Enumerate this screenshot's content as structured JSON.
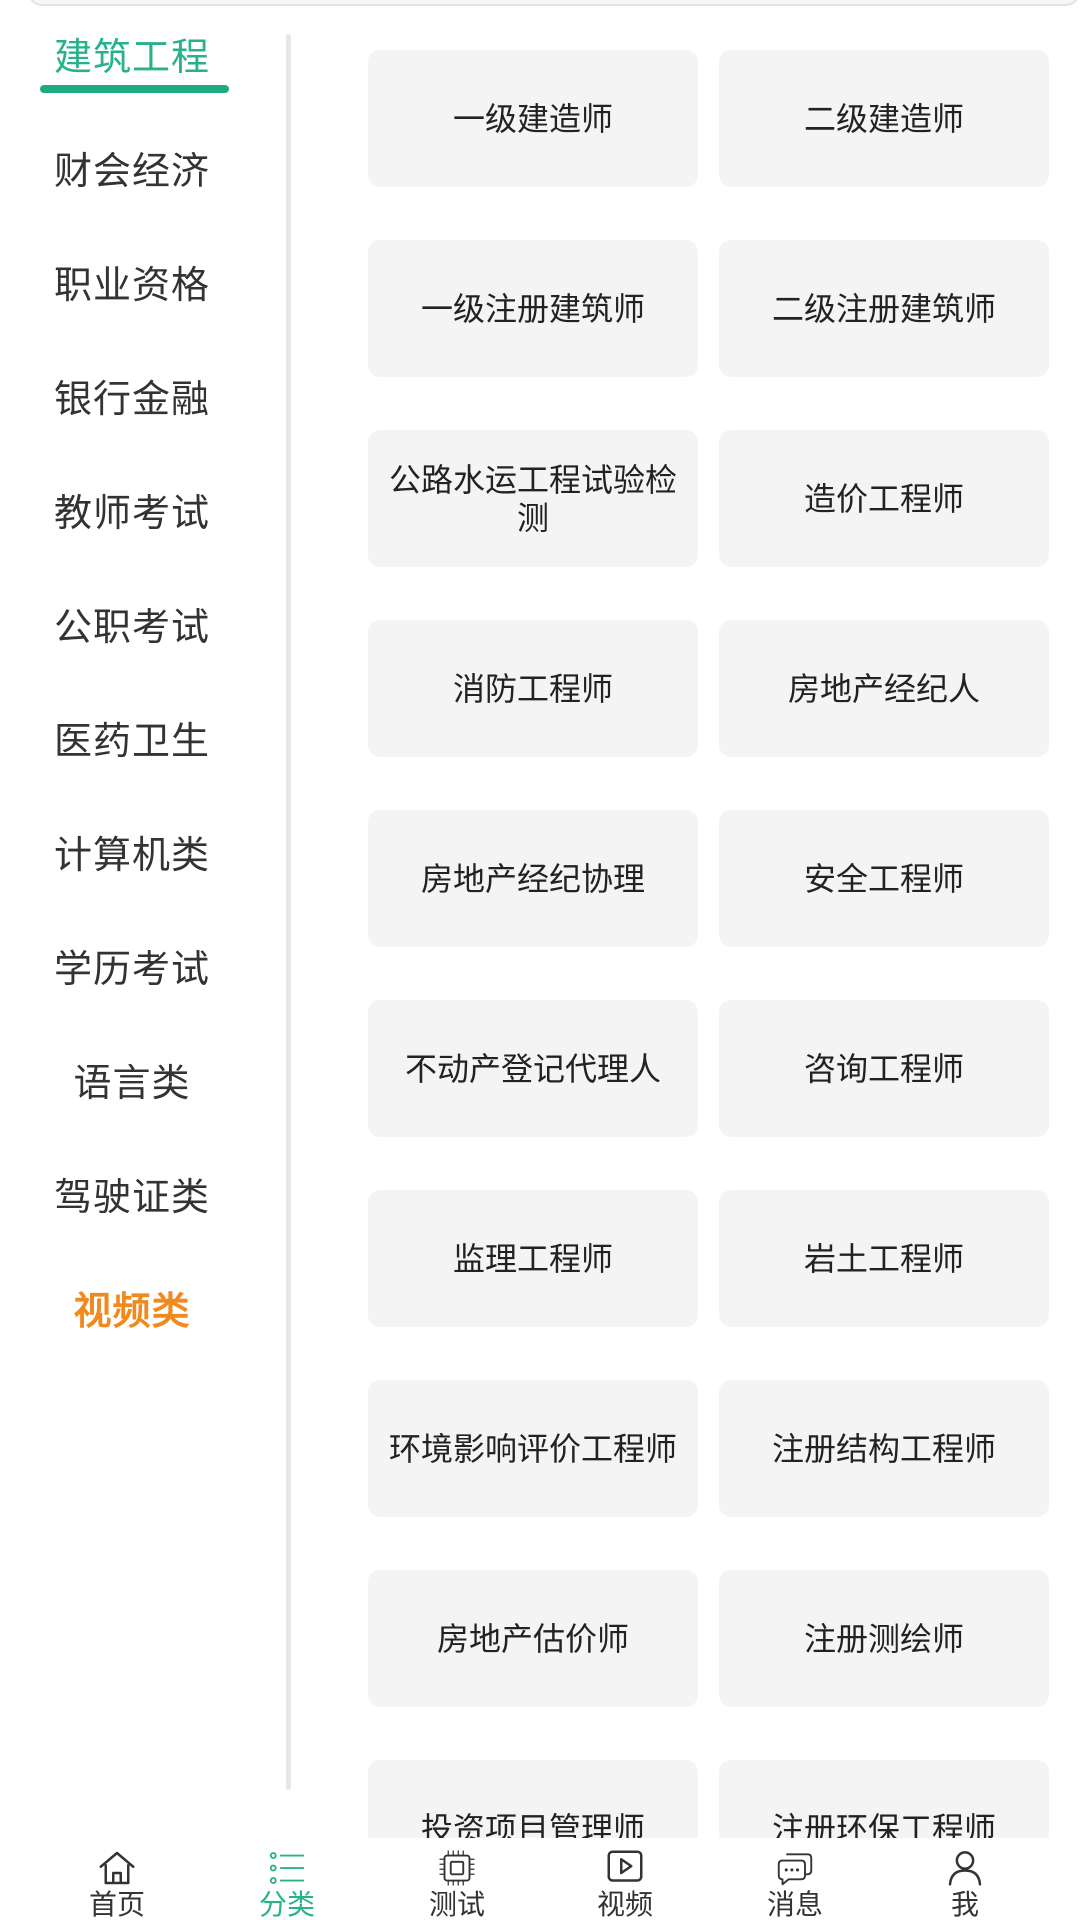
{
  "sidebar": {
    "items": [
      {
        "label": "建筑工程"
      },
      {
        "label": "财会经济"
      },
      {
        "label": "职业资格"
      },
      {
        "label": "银行金融"
      },
      {
        "label": "教师考试"
      },
      {
        "label": "公职考试"
      },
      {
        "label": "医药卫生"
      },
      {
        "label": "计算机类"
      },
      {
        "label": "学历考试"
      },
      {
        "label": "语言类"
      },
      {
        "label": "驾驶证类"
      },
      {
        "label": "视频类"
      }
    ],
    "active_index": 0,
    "active_color": "#27b28b",
    "highlight_color": "#f08a1f"
  },
  "categories": [
    {
      "label": "一级建造师"
    },
    {
      "label": "二级建造师"
    },
    {
      "label": "一级注册建筑师"
    },
    {
      "label": "二级注册建筑师"
    },
    {
      "label": "公路水运工程试验检测"
    },
    {
      "label": "造价工程师"
    },
    {
      "label": "消防工程师"
    },
    {
      "label": "房地产经纪人"
    },
    {
      "label": "房地产经纪协理"
    },
    {
      "label": "安全工程师"
    },
    {
      "label": "不动产登记代理人"
    },
    {
      "label": "咨询工程师"
    },
    {
      "label": "监理工程师"
    },
    {
      "label": "岩土工程师"
    },
    {
      "label": "环境影响评价工程师"
    },
    {
      "label": "注册结构工程师"
    },
    {
      "label": "房地产估价师"
    },
    {
      "label": "注册测绘师"
    },
    {
      "label": "投资项目管理师"
    },
    {
      "label": "注册环保工程师"
    }
  ],
  "bottom_nav": {
    "items": [
      {
        "label": "首页",
        "icon": "home-icon"
      },
      {
        "label": "分类",
        "icon": "list-icon"
      },
      {
        "label": "测试",
        "icon": "chip-icon"
      },
      {
        "label": "视频",
        "icon": "play-icon"
      },
      {
        "label": "消息",
        "icon": "chat-icon"
      },
      {
        "label": "我",
        "icon": "user-icon"
      }
    ],
    "selected_index": 1
  }
}
